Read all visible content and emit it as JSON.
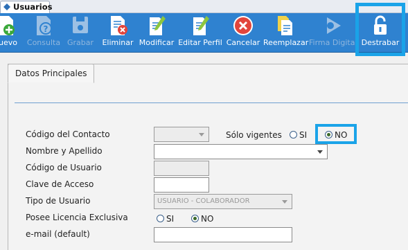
{
  "window_tab": {
    "title": "Usuarios"
  },
  "toolbar": {
    "nuevo": "uevo",
    "consulta": "Consulta",
    "grabar": "Grabar",
    "eliminar": "Eliminar",
    "modificar": "Modificar",
    "editar_perfil": "Editar Perfil",
    "cancelar": "Cancelar",
    "reemplazar": "Reemplazar",
    "firma_digital": "Firma Digital",
    "destrabar": "Destrabar"
  },
  "form": {
    "tab_label": "Datos Principales",
    "codigo_contacto_label": "Código del Contacto",
    "solo_vigentes_label": "Sólo vigentes",
    "si_label": "SI",
    "no_label": "NO",
    "nombre_label": "Nombre y Apellido",
    "codigo_usuario_label": "Código de Usuario",
    "clave_label": "Clave de Acceso",
    "tipo_label": "Tipo de Usuario",
    "tipo_value": "USUARIO - COLABORADOR",
    "licencia_label": "Posee Licencia Exclusiva",
    "licencia_si": "SI",
    "licencia_no": "NO",
    "email_label": "e-mail (default)"
  },
  "colors": {
    "toolbar_bg": "#2f82d0",
    "highlight": "#1aa3e8"
  }
}
